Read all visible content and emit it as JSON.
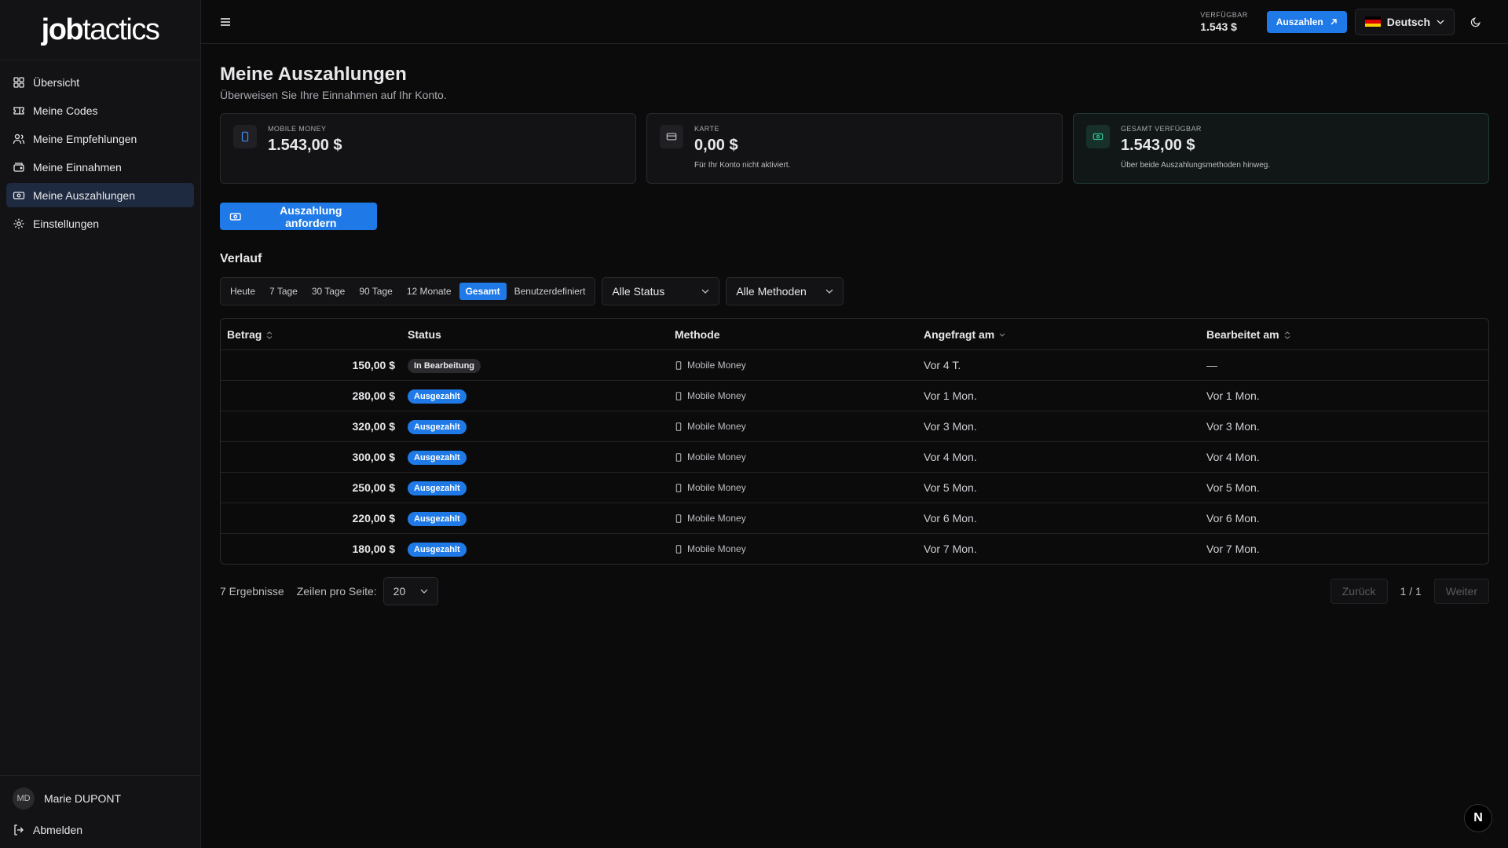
{
  "brand": {
    "logo_bold": "job",
    "logo_light": "tactics"
  },
  "sidebar": {
    "items": [
      {
        "label": "Übersicht",
        "icon": "grid-icon"
      },
      {
        "label": "Meine Codes",
        "icon": "ticket-icon"
      },
      {
        "label": "Meine Empfehlungen",
        "icon": "users-icon"
      },
      {
        "label": "Meine Einnahmen",
        "icon": "wallet-icon"
      },
      {
        "label": "Meine Auszahlungen",
        "icon": "banknote-icon",
        "active": true
      },
      {
        "label": "Einstellungen",
        "icon": "gear-icon"
      }
    ],
    "user": {
      "initials": "MD",
      "name": "Marie DUPONT"
    },
    "logout_label": "Abmelden"
  },
  "header": {
    "available_label": "VERFÜGBAR",
    "available_value": "1.543 $",
    "withdraw_button": "Auszahlen",
    "language": "Deutsch"
  },
  "page": {
    "title": "Meine Auszahlungen",
    "subtitle": "Überweisen Sie Ihre Einnahmen auf Ihr Konto."
  },
  "cards": [
    {
      "label": "MOBILE MONEY",
      "value": "1.543,00 $",
      "note": ""
    },
    {
      "label": "KARTE",
      "value": "0,00 $",
      "note": "Für Ihr Konto nicht aktiviert."
    },
    {
      "label": "GESAMT VERFÜGBAR",
      "value": "1.543,00 $",
      "note": "Über beide Auszahlungsmethoden hinweg."
    }
  ],
  "request_button": "Auszahlung anfordern",
  "history": {
    "title": "Verlauf",
    "ranges": [
      "Heute",
      "7 Tage",
      "30 Tage",
      "90 Tage",
      "12 Monate",
      "Gesamt",
      "Benutzerdefiniert"
    ],
    "active_range": "Gesamt",
    "status_filter": "Alle Status",
    "method_filter": "Alle Methoden"
  },
  "table": {
    "columns": [
      "Betrag",
      "Status",
      "Methode",
      "Angefragt am",
      "Bearbeitet am"
    ],
    "rows": [
      {
        "amount": "150,00 $",
        "status": "In Bearbeitung",
        "status_type": "proc",
        "method": "Mobile Money",
        "requested": "Vor 4 T.",
        "processed": "—"
      },
      {
        "amount": "280,00 $",
        "status": "Ausgezahlt",
        "status_type": "paid",
        "method": "Mobile Money",
        "requested": "Vor 1 Mon.",
        "processed": "Vor 1 Mon."
      },
      {
        "amount": "320,00 $",
        "status": "Ausgezahlt",
        "status_type": "paid",
        "method": "Mobile Money",
        "requested": "Vor 3 Mon.",
        "processed": "Vor 3 Mon."
      },
      {
        "amount": "300,00 $",
        "status": "Ausgezahlt",
        "status_type": "paid",
        "method": "Mobile Money",
        "requested": "Vor 4 Mon.",
        "processed": "Vor 4 Mon."
      },
      {
        "amount": "250,00 $",
        "status": "Ausgezahlt",
        "status_type": "paid",
        "method": "Mobile Money",
        "requested": "Vor 5 Mon.",
        "processed": "Vor 5 Mon."
      },
      {
        "amount": "220,00 $",
        "status": "Ausgezahlt",
        "status_type": "paid",
        "method": "Mobile Money",
        "requested": "Vor 6 Mon.",
        "processed": "Vor 6 Mon."
      },
      {
        "amount": "180,00 $",
        "status": "Ausgezahlt",
        "status_type": "paid",
        "method": "Mobile Money",
        "requested": "Vor 7 Mon.",
        "processed": "Vor 7 Mon."
      }
    ]
  },
  "footer": {
    "results": "7 Ergebnisse",
    "rows_per_page_label": "Zeilen pro Seite:",
    "rows_per_page": "20",
    "prev": "Zurück",
    "page_info": "1 / 1",
    "next": "Weiter"
  },
  "corner_badge": "N",
  "colors": {
    "accent": "#1f7ae8",
    "background": "#0b0b0c",
    "sidebar": "#131315"
  }
}
